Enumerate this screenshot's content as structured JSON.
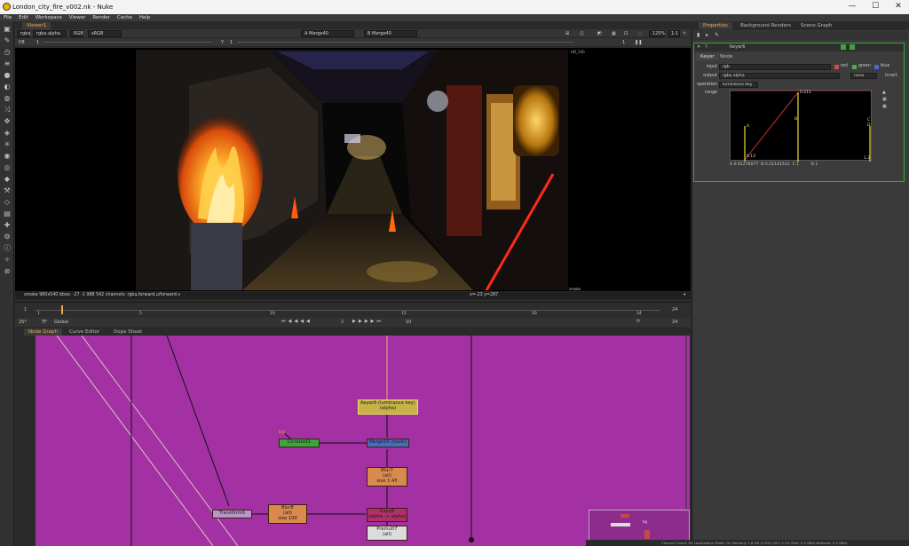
{
  "window": {
    "title": "London_city_fire_v002.nk - Nuke",
    "minimize": "—",
    "maximize": "☐",
    "close": "✕"
  },
  "menu": [
    "File",
    "Edit",
    "Workspace",
    "Viewer",
    "Render",
    "Cache",
    "Help"
  ],
  "viewer": {
    "tab": "Viewer1",
    "channels": "rgba",
    "layer": "rgba.alpha",
    "colorspace": "RGB",
    "lut": "sRGB",
    "input_a": "A  Merge40",
    "input_b": "B  Merge40",
    "zoom": "125%",
    "ratio": "1:1",
    "gain_label": "f/8",
    "gain_value": "1",
    "gamma_label": "Y",
    "gamma_value": "1",
    "frame_label": "1",
    "image_label": "smoke",
    "format_label": "HD_540",
    "status_left": "smoke 960x540  bbox: -27 -1 988 542 channels: rgba,forward.u/forward.v",
    "status_right": "x=-23 y=287"
  },
  "timeline": {
    "ticks": [
      "1",
      "5",
      "10",
      "15",
      "20",
      "24"
    ],
    "fps": "25*",
    "tf": "TF",
    "mode": "Global",
    "current_frame": "2",
    "step": "10",
    "end_frame": "24",
    "in_frame": "1"
  },
  "graph_tabs": [
    "Node Graph",
    "Curve Editor",
    "Dope Sheet"
  ],
  "nodes": {
    "keyer": {
      "title": "Keyer6 (luminance key)",
      "sub": "(alpha)"
    },
    "bg": "bg",
    "constant": "Constant1",
    "merge": "Merge16 (mask)",
    "blur7": {
      "title": "Blur7",
      "sub": "(all)",
      "size": "size 1.45"
    },
    "blur8": {
      "title": "Blur8",
      "sub": "(all)",
      "size": "size 100"
    },
    "transform": "Transform6",
    "copy": {
      "title": "Copy8",
      "sub": "(alpha -> alpha)"
    },
    "premult": {
      "title": "Premult7",
      "sub": "(all)"
    },
    "mini": "bg"
  },
  "right_tabs": [
    "Properties",
    "Background Renders",
    "Scene Graph"
  ],
  "properties": {
    "node_name": "Keyer6",
    "tabs": [
      "Keyer",
      "Node"
    ],
    "input_label": "input",
    "input_value": "rgb",
    "channels": [
      "red",
      "green",
      "blue"
    ],
    "output_label": "output",
    "output_value": "rgba.alpha",
    "output_extra": "none",
    "invert": "invert",
    "operation_label": "operation",
    "operation_value": "luminance key",
    "range_label": "range",
    "curve_labels": {
      "a": "A",
      "b": "B",
      "c": "C",
      "d": "D",
      "top": "0.211",
      "bottom": "0.13",
      "right": "1.2"
    },
    "range_values": "A 0.01276077  B 0.21141512  C 1         D 1"
  },
  "statusbar": "Channel Count: 63  Localization Mode: On  Memory: 1.6 GB (2.5%)  CPU: 2.1%  Disk: 0.0 MB/s  Network: 0.0 MB/s",
  "colors": {
    "graph_bg": "#a431a4",
    "accent": "#f2a64d",
    "keyer_node": "#c7b24a",
    "blur_node": "#d98a4e",
    "selection_green": "#2faa2f"
  }
}
